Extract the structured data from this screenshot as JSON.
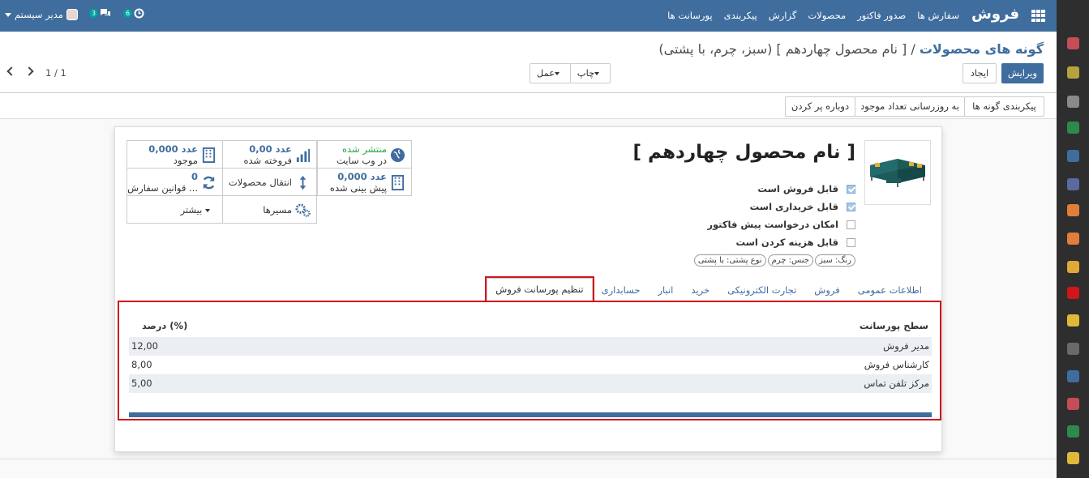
{
  "topbar": {
    "brand": "فروش",
    "menu": [
      "سفارش ها",
      "صدور فاکتور",
      "محصولات",
      "گزارش",
      "پیکربندی",
      "پورسانت ها"
    ],
    "badge_activity": "6",
    "badge_messages": "3",
    "user_name": "مدیر سیستم"
  },
  "breadcrumb": {
    "parent": "گونه های محصولات",
    "separator": "/",
    "current": "[ نام محصول چهاردهم ] (سبز، چرم، با پشتی)"
  },
  "buttons": {
    "edit": "ویرایش",
    "create": "ایجاد",
    "print": "چاپ",
    "action": "عمل"
  },
  "pager": {
    "value": "1 / 1"
  },
  "header_buttons": [
    "پیکربندی گونه ها",
    "به روزرسانی تعداد موجود",
    "دوباره پر کردن"
  ],
  "product": {
    "name": "[ نام محصول چهاردهم ]",
    "checkboxes": [
      {
        "label": "قابل فروش است",
        "checked": true
      },
      {
        "label": "قابل خریداری است",
        "checked": true
      },
      {
        "label": "امکان درخواست پیش فاکتور",
        "checked": false
      },
      {
        "label": "قابل هزینه کردن است",
        "checked": false
      }
    ],
    "tags": [
      "رنگ: سبز",
      "جنس: چرم",
      "نوع پشتی: با پشتی"
    ]
  },
  "smart_buttons": {
    "website": {
      "line1": "منتشر شده",
      "line2": "در وب سایت"
    },
    "sold": {
      "line1": "0,00 عدد",
      "line2": "فروخته شده"
    },
    "onhand": {
      "line1": "0,000 عدد",
      "line2": "موجود"
    },
    "forecast": {
      "line1": "0,000 عدد",
      "line2": "پیش بینی شده"
    },
    "moves": {
      "line1": "انتقال محصولات"
    },
    "reorder": {
      "line1": "0",
      "line2": "قوانین سفارش ..."
    },
    "routes": {
      "line1": "مسیرها"
    },
    "more": {
      "line1": "بیشتر"
    }
  },
  "tabs": [
    "اطلاعات عمومی",
    "فروش",
    "تجارت الکترونیکی",
    "خرید",
    "انبار",
    "حسابداری",
    "تنظیم پورسانت فروش"
  ],
  "commission_table": {
    "headers": [
      "سطح پورسانت",
      "درصد (%)"
    ],
    "rows": [
      [
        "مدیر فروش",
        "12,00"
      ],
      [
        "کارشناس فروش",
        "8,00"
      ],
      [
        "مرکز تلفن تماس",
        "5,00"
      ]
    ]
  },
  "colors": {
    "brand": "#3f6d9e",
    "highlight": "#d0151b",
    "badge": "#00a09d"
  }
}
